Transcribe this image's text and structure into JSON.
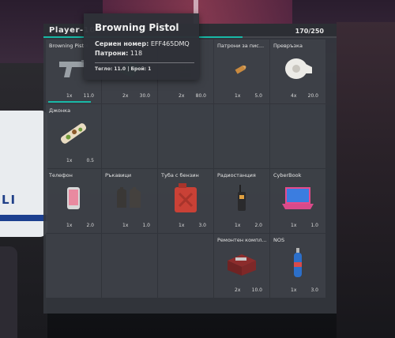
{
  "inventory": {
    "title": "Player-10",
    "weight_text": "170/250",
    "weight_fraction": 0.68
  },
  "slots": [
    {
      "label": "Browning Pistol",
      "count": "1x",
      "weight": "11.0",
      "icon": "pistol-icon",
      "durability": 1.0
    },
    {
      "label": "",
      "count": "2x",
      "weight": "30.0",
      "icon": "green-item-icon"
    },
    {
      "label": "Жилетка",
      "count": "2x",
      "weight": "80.0",
      "icon": "vest-icon"
    },
    {
      "label": "Патрони за пис...",
      "count": "1x",
      "weight": "5.0",
      "icon": "bullet-icon"
    },
    {
      "label": "Превръзка",
      "count": "4x",
      "weight": "20.0",
      "icon": "bandage-icon"
    },
    {
      "label": "Джонка",
      "count": "1x",
      "weight": "0.5",
      "icon": "joint-icon"
    },
    {
      "label": "",
      "count": "",
      "weight": "",
      "icon": ""
    },
    {
      "label": "",
      "count": "",
      "weight": "",
      "icon": ""
    },
    {
      "label": "",
      "count": "",
      "weight": "",
      "icon": ""
    },
    {
      "label": "",
      "count": "",
      "weight": "",
      "icon": ""
    },
    {
      "label": "Телефон",
      "count": "1x",
      "weight": "2.0",
      "icon": "phone-icon"
    },
    {
      "label": "Ръкавици",
      "count": "1x",
      "weight": "1.0",
      "icon": "gloves-icon"
    },
    {
      "label": "Туба с бензин",
      "count": "1x",
      "weight": "3.0",
      "icon": "jerrycan-icon"
    },
    {
      "label": "Радиостанция",
      "count": "1x",
      "weight": "2.0",
      "icon": "radio-icon"
    },
    {
      "label": "CyberBook",
      "count": "1x",
      "weight": "1.0",
      "icon": "laptop-icon"
    },
    {
      "label": "",
      "count": "",
      "weight": "",
      "icon": ""
    },
    {
      "label": "",
      "count": "",
      "weight": "",
      "icon": ""
    },
    {
      "label": "",
      "count": "",
      "weight": "",
      "icon": ""
    },
    {
      "label": "Ремонтен компл...",
      "count": "2x",
      "weight": "10.0",
      "icon": "repair-kit-icon"
    },
    {
      "label": "NOS",
      "count": "1x",
      "weight": "3.0",
      "icon": "nos-bottle-icon"
    }
  ],
  "tooltip": {
    "title": "Browning Pistol",
    "serial_label": "Сериен номер:",
    "serial_value": "EFF465DMQ",
    "ammo_label": "Патрони:",
    "ammo_value": "118",
    "footer": "Тегло: 11.0 | Брой: 1"
  },
  "background": {
    "car_text": "LI"
  },
  "colors": {
    "accent": "#18b8a6",
    "panel": "#34373d",
    "text": "#e6e6e6"
  }
}
